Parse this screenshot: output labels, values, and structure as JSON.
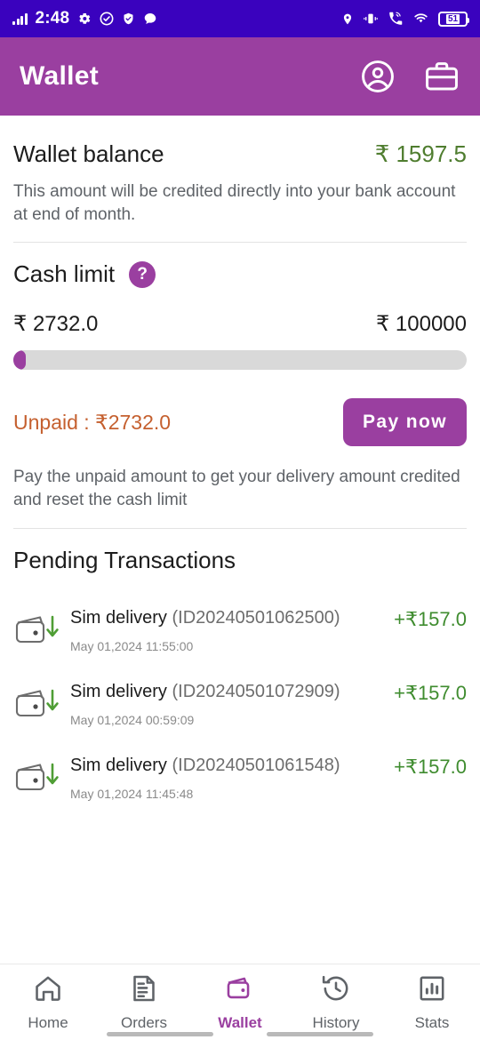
{
  "status_bar": {
    "time": "2:48",
    "battery_level": "51",
    "left_icons": [
      "signal-bars-icon",
      "gear-icon",
      "check-circle-icon",
      "shield-check-icon",
      "chat-bubble-icon"
    ],
    "right_icons": [
      "location-pin-icon",
      "vibrate-icon",
      "wifi-calling-icon",
      "wifi-icon",
      "battery-icon"
    ],
    "background_color": "#3a02be"
  },
  "app_bar": {
    "title": "Wallet",
    "background_color": "#9a3fa0",
    "actions": [
      "account-circle-icon",
      "briefcase-icon"
    ]
  },
  "balance": {
    "label": "Wallet balance",
    "amount": "₹ 1597.5",
    "amount_color": "#4f7d2f",
    "note": "This amount will be credited directly into your bank account at end of month."
  },
  "cash_limit": {
    "title": "Cash limit",
    "help_icon": "?",
    "used": "₹ 2732.0",
    "total": "₹ 100000",
    "progress_percent": 2.7,
    "progress_color": "#9a3fa0",
    "track_color": "#d9d9d9"
  },
  "unpaid": {
    "text": "Unpaid : ₹2732.0",
    "text_color": "#c5602f",
    "pay_button_label": "Pay now",
    "note": "Pay the unpaid amount to get your delivery amount credited and reset the cash limit"
  },
  "pending": {
    "title": "Pending Transactions",
    "transactions": [
      {
        "icon": "wallet-in-icon",
        "title": "Sim delivery ",
        "id": "(ID20240501062500)",
        "date": "May 01,2024 11:55:00",
        "amount": "+₹157.0"
      },
      {
        "icon": "wallet-in-icon",
        "title": "Sim delivery ",
        "id": "(ID20240501072909)",
        "date": "May 01,2024 00:59:09",
        "amount": "+₹157.0"
      },
      {
        "icon": "wallet-in-icon",
        "title": "Sim delivery ",
        "id": "(ID20240501061548)",
        "date": "May 01,2024 11:45:48",
        "amount": "+₹157.0"
      }
    ]
  },
  "bottom_nav": {
    "active": "Wallet",
    "active_color": "#9a3fa0",
    "items": [
      {
        "label": "Home",
        "icon": "home-icon"
      },
      {
        "label": "Orders",
        "icon": "document-list-icon"
      },
      {
        "label": "Wallet",
        "icon": "wallet-icon"
      },
      {
        "label": "History",
        "icon": "history-clock-icon"
      },
      {
        "label": "Stats",
        "icon": "bar-chart-icon"
      }
    ]
  }
}
